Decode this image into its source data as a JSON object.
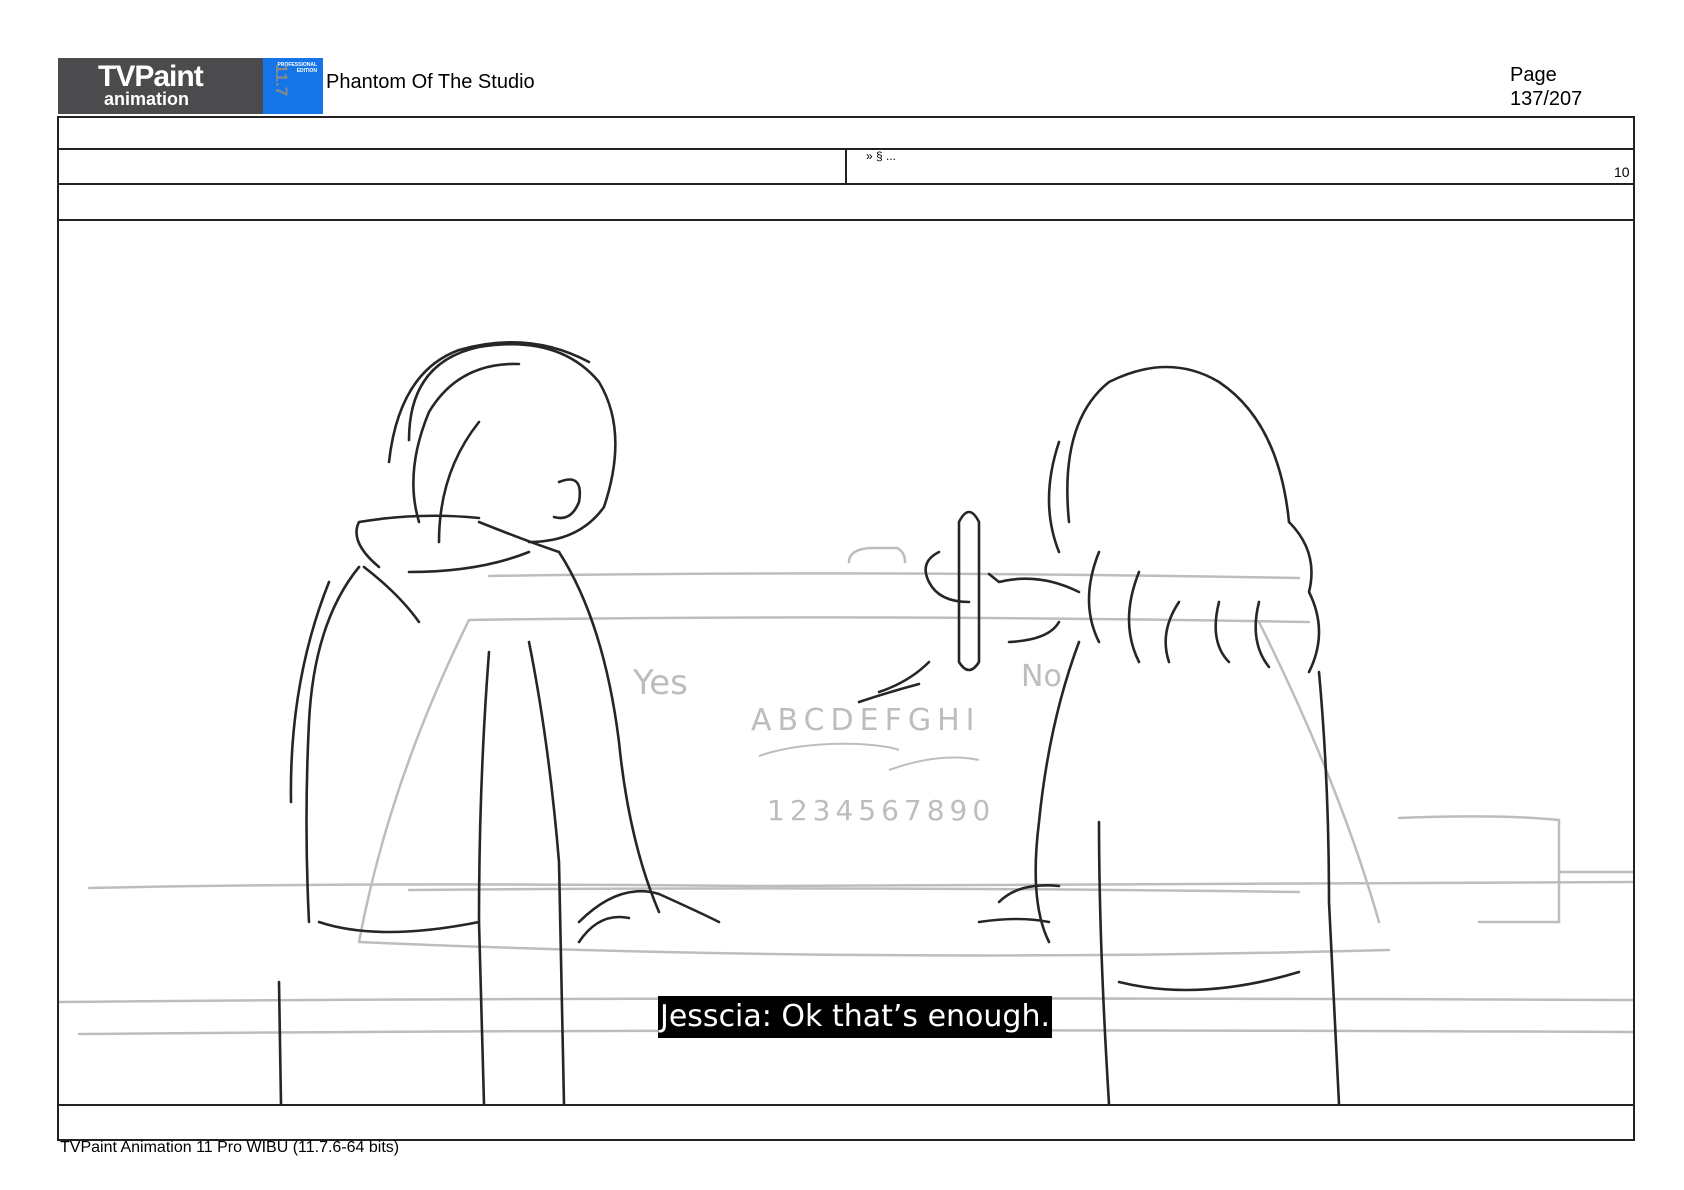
{
  "header": {
    "logo_main": "TVPaint",
    "logo_sub": "animation",
    "logo_version": "11.7",
    "logo_edition_line1": "PROFESSIONAL",
    "logo_edition_line2": "EDITION",
    "project_title": "Phantom Of The Studio",
    "page_label": "Page",
    "page_number": "137/207"
  },
  "row": {
    "code": "» § ...",
    "corner_number": "10"
  },
  "panel": {
    "board_text_yes": "Yes",
    "board_text_no": "No",
    "board_letters": "ABCDEFGHI",
    "board_numbers": "1234567890",
    "subtitle": "Jesscia: Ok that’s enough."
  },
  "footer": {
    "software": "TVPaint Animation 11 Pro WIBU (11.7.6-64 bits)"
  }
}
